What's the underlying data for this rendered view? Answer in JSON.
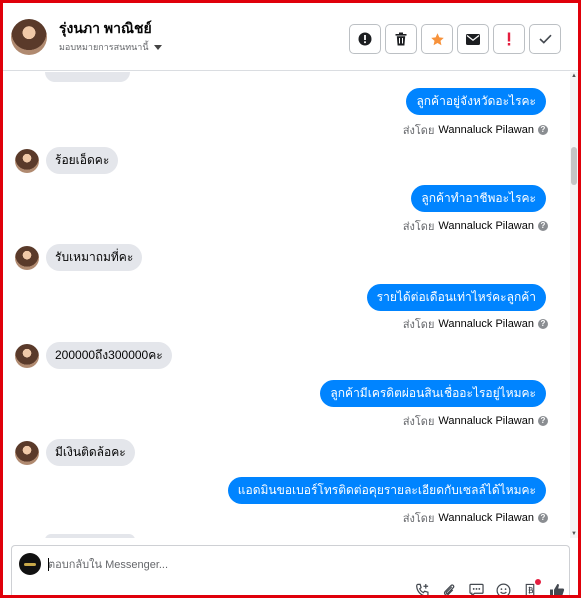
{
  "header": {
    "name": "รุ่งนภา พาณิชย์",
    "assign_label": "มอบหมายการสนทนานี้",
    "actions": [
      {
        "name": "report-button",
        "icon": "exclamation-circle-icon",
        "color": "#1c1e21"
      },
      {
        "name": "delete-button",
        "icon": "trash-icon",
        "color": "#1c1e21"
      },
      {
        "name": "star-button",
        "icon": "star-icon",
        "color": "#f7923b"
      },
      {
        "name": "mark-unread-button",
        "icon": "envelope-icon",
        "color": "#1c1e21"
      },
      {
        "name": "follow-up-button",
        "icon": "exclamation-icon",
        "color": "#e41e3f"
      },
      {
        "name": "done-button",
        "icon": "check-icon",
        "color": "#444950"
      }
    ]
  },
  "messages": [
    {
      "dir": "out",
      "text": "ลูกค้าอยู่จังหวัดอะไรคะ"
    },
    {
      "dir": "in",
      "text": "ร้อยเอ็ดคะ"
    },
    {
      "dir": "out",
      "text": "ลูกค้าทำอาชีพอะไรคะ"
    },
    {
      "dir": "in",
      "text": "รับเหมาถมที่คะ"
    },
    {
      "dir": "out",
      "text": "รายได้ต่อเดือนเท่าไหร่คะลูกค้า"
    },
    {
      "dir": "in",
      "text": "200000ถึง300000คะ"
    },
    {
      "dir": "out",
      "text": "ลูกค้ามีเครดิตผ่อนสินเชื่ออะไรอยู่ไหมคะ"
    },
    {
      "dir": "in",
      "text": "มีเงินติดล้อคะ"
    },
    {
      "dir": "out",
      "text": "แอดมินขอเบอร์โทรติดต่อคุยรายละเอียดกับเซลล์ได้ไหมคะ"
    }
  ],
  "sent_by": {
    "prefix": "ส่งโดย",
    "agent": "Wannaluck Pilawan",
    "help": "?"
  },
  "composer": {
    "placeholder": "ตอบกลับใน Messenger..."
  },
  "colors": {
    "outgoing_bubble": "#0084ff",
    "incoming_bubble": "#e4e6eb",
    "frame": "#e0000a"
  }
}
